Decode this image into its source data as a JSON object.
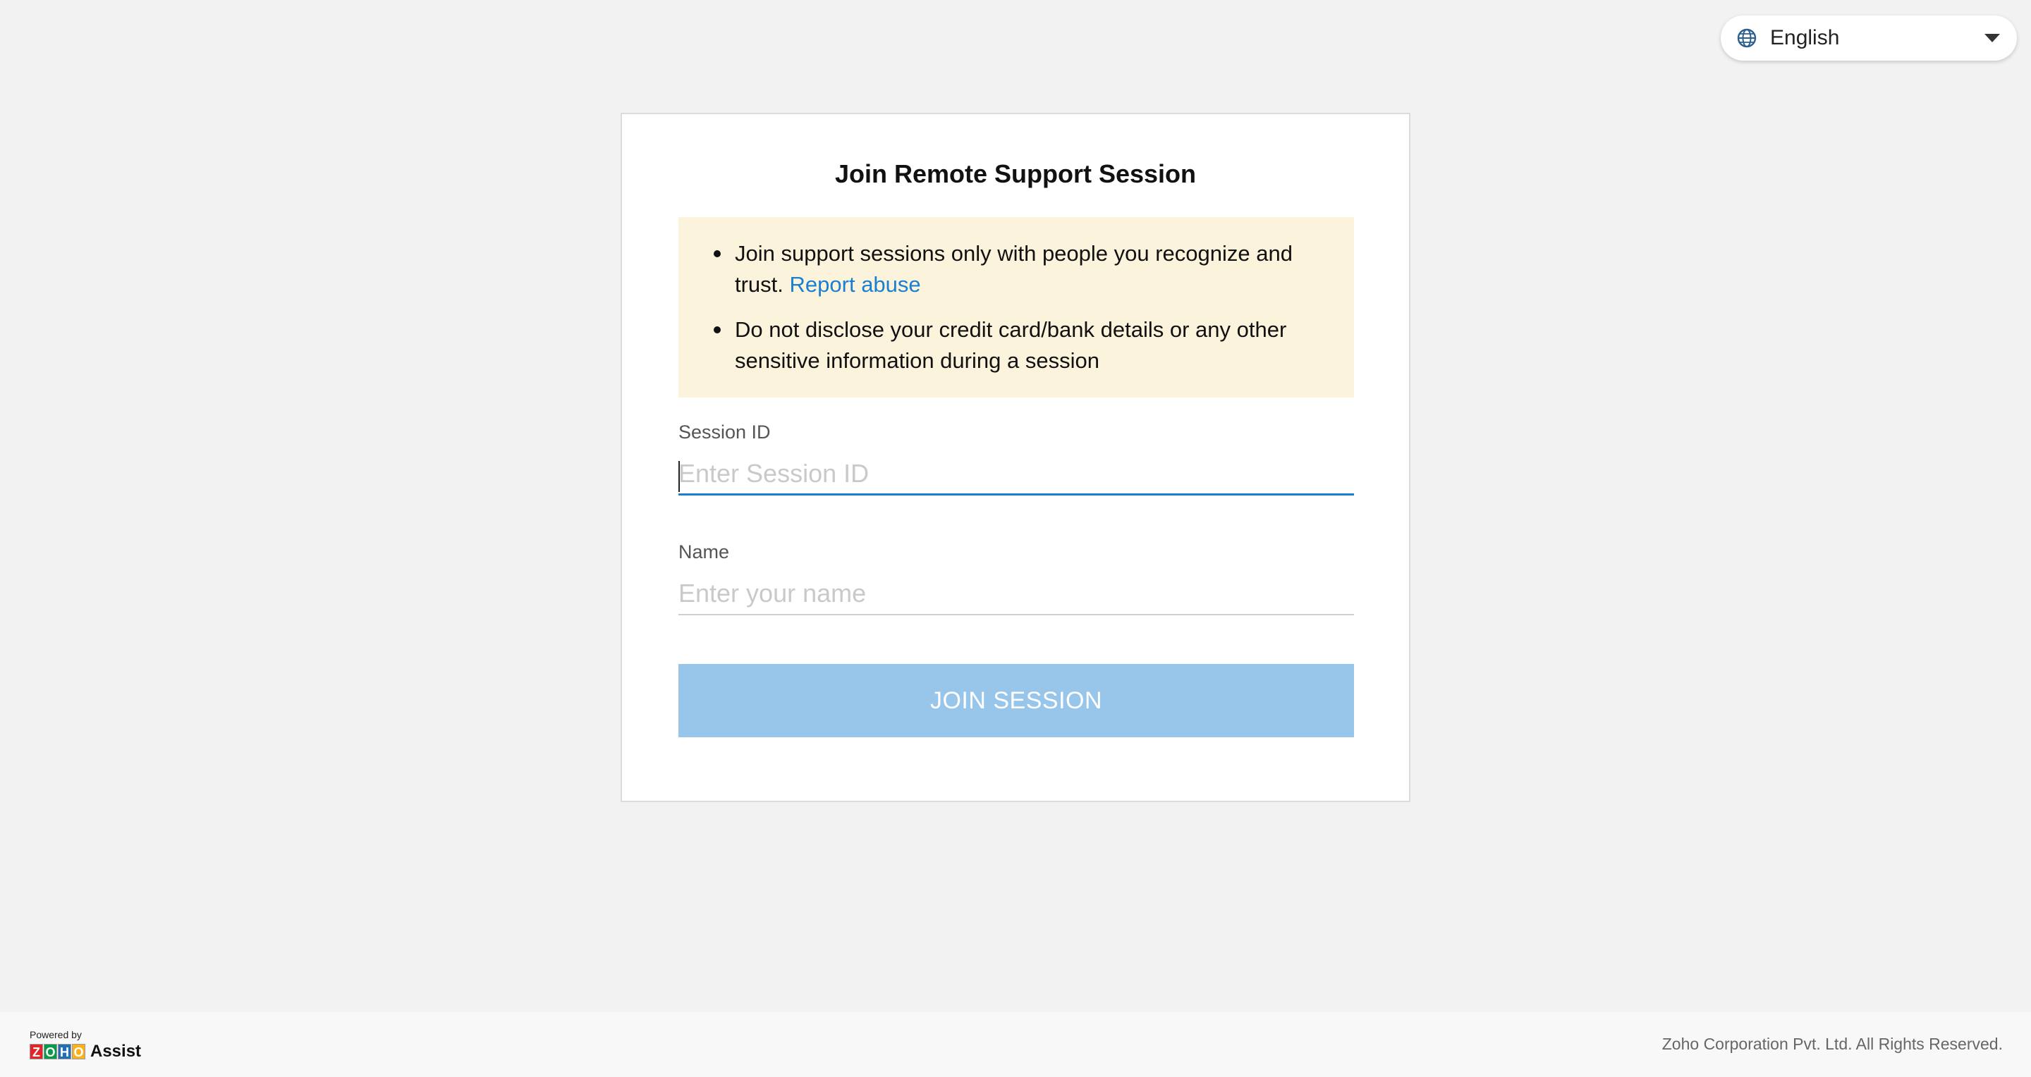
{
  "language": {
    "selected": "English",
    "icon": "globe-icon"
  },
  "card": {
    "title": "Join Remote Support Session",
    "notice": {
      "item1_text": "Join support sessions only with people you recognize and trust.",
      "item1_link": "Report abuse",
      "item2_text": "Do not disclose your credit card/bank details or any other sensitive information during a session"
    },
    "session_id": {
      "label": "Session ID",
      "placeholder": "Enter Session ID",
      "value": ""
    },
    "name": {
      "label": "Name",
      "placeholder": "Enter your name",
      "value": ""
    },
    "join_button": "JOIN SESSION"
  },
  "footer": {
    "powered_by": "Powered by",
    "zoho_letters": [
      "Z",
      "O",
      "H",
      "O"
    ],
    "zoho_colors": [
      "#e42527",
      "#089949",
      "#226db4",
      "#f9b21d"
    ],
    "product": "Assist",
    "copyright": "Zoho Corporation Pvt. Ltd. All Rights Reserved."
  },
  "colors": {
    "accent": "#1a7fd1",
    "button_disabled": "#98c5ea",
    "notice_bg": "#fcf3dc"
  }
}
